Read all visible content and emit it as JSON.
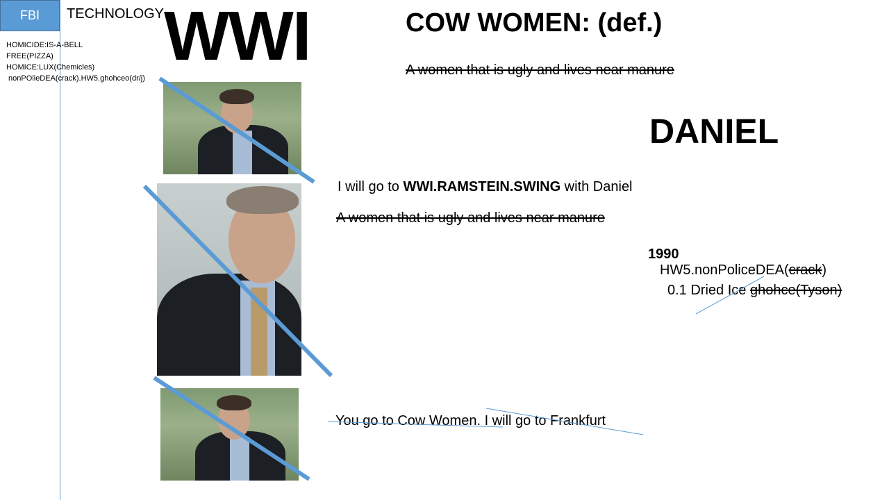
{
  "header": {
    "box_label": "FBI",
    "technology": "TECHNOLOGY",
    "big_title": "WWI"
  },
  "notes": {
    "line1": "HOMICIDE:IS-A-BELL",
    "line2": "FREE(PIZZA)",
    "line3": "HOMICE:LUX(Chemicles)",
    "line4": " nonPOlieDEA(crack).HW5.ghohceo(dr/j)"
  },
  "definition": {
    "title": "COW WOMEN: (def.)",
    "text": "A women that is ugly and lives near manure"
  },
  "name": "DANIEL",
  "statement": {
    "prefix": "I will go to ",
    "bold": "WWI.RAMSTEIN.SWING",
    "suffix": " with Daniel"
  },
  "definition_repeat": "A women that is ugly and lives near manure",
  "year_block": {
    "year": "1990",
    "hw5_prefix": "HW5.nonPoliceDEA(",
    "hw5_struck": "crack",
    "hw5_suffix": ")",
    "dried_prefix": "0.1 Dried Ice ",
    "dried_struck": "ghohce(Tyson)"
  },
  "bottom_line": "You go to Cow Women. I will go to Frankfurt",
  "colors": {
    "accent": "#5b9bd5"
  }
}
